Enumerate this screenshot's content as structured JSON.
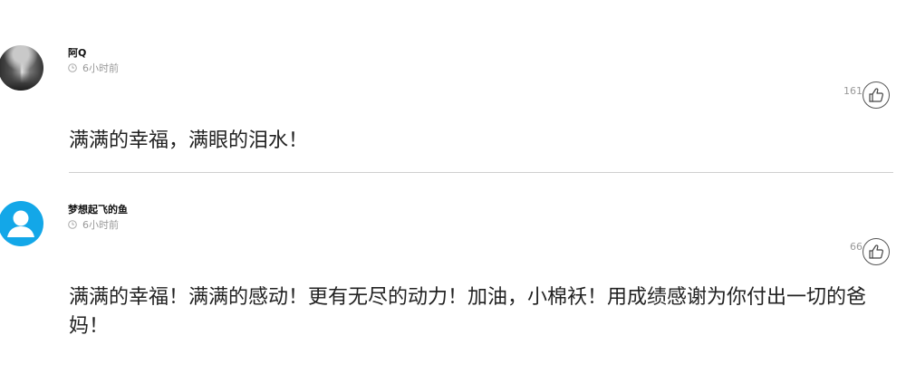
{
  "comments": [
    {
      "username": "阿Q",
      "time": "6小时前",
      "likes": "161",
      "text": "满满的幸福，满眼的泪水！",
      "avatar": "photo"
    },
    {
      "username": "梦想起飞的鱼",
      "time": "6小时前",
      "likes": "66",
      "text": "满满的幸福！满满的感动！更有无尽的动力！加油，小棉袄！用成绩感谢为你付出一切的爸妈！",
      "avatar": "default-user-icon"
    }
  ],
  "colors": {
    "default_avatar": "#13a7e8",
    "meta_text": "#999999",
    "divider": "#cfcfcf"
  }
}
